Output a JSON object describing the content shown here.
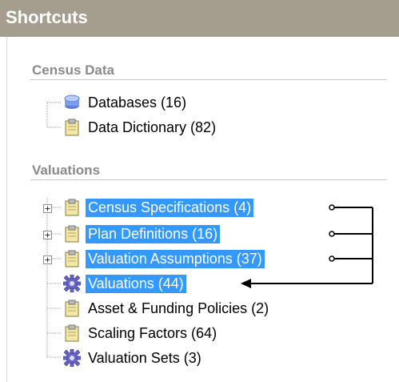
{
  "header": {
    "title": "Shortcuts"
  },
  "sections": [
    {
      "title": "Census Data",
      "items": [
        {
          "label": "Databases (16)",
          "icon": "database-icon",
          "selected": false,
          "expandable": false
        },
        {
          "label": "Data Dictionary (82)",
          "icon": "clipboard-icon",
          "selected": false,
          "expandable": false
        }
      ]
    },
    {
      "title": "Valuations",
      "items": [
        {
          "label": "Census Specifications (4)",
          "icon": "clipboard-icon",
          "selected": true,
          "expandable": true
        },
        {
          "label": "Plan Definitions (16)",
          "icon": "clipboard-icon",
          "selected": true,
          "expandable": true
        },
        {
          "label": "Valuation Assumptions (37)",
          "icon": "clipboard-icon",
          "selected": true,
          "expandable": true
        },
        {
          "label": "Valuations (44)",
          "icon": "gear-icon",
          "selected": true,
          "expandable": false
        },
        {
          "label": "Asset & Funding Policies (2)",
          "icon": "clipboard-icon",
          "selected": false,
          "expandable": false
        },
        {
          "label": "Scaling Factors (64)",
          "icon": "clipboard-icon",
          "selected": false,
          "expandable": false
        },
        {
          "label": "Valuation Sets (3)",
          "icon": "gear-icon",
          "selected": false,
          "expandable": false
        }
      ]
    }
  ],
  "colors": {
    "header_bg": "#a59e8e",
    "selection": "#3399ff",
    "section_title": "#8a8a8a"
  }
}
